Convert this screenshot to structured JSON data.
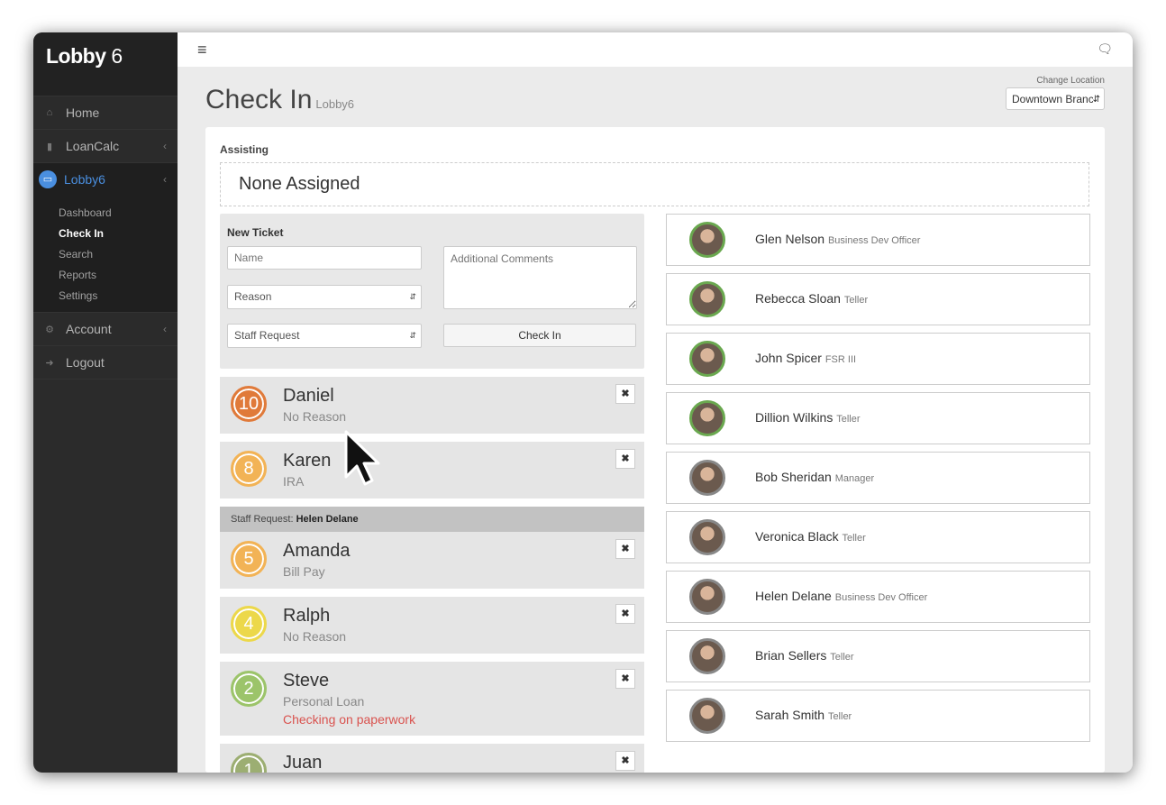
{
  "app": {
    "brand": "Lobby",
    "brand_suffix": "6"
  },
  "sidebar": {
    "items": [
      {
        "label": "Home",
        "icon": "home-icon"
      },
      {
        "label": "LoanCalc",
        "icon": "bar-chart-icon"
      },
      {
        "label": "Lobby6",
        "icon": "tablet-icon"
      },
      {
        "label": "Account",
        "icon": "gear-icon"
      },
      {
        "label": "Logout",
        "icon": "logout-icon"
      }
    ],
    "subitems": [
      "Dashboard",
      "Check In",
      "Search",
      "Reports",
      "Settings"
    ]
  },
  "page": {
    "title": "Check In",
    "subtitle": "Lobby6",
    "location_label": "Change Location",
    "location_value": "Downtown Branch"
  },
  "assisting": {
    "label": "Assisting",
    "value": "None Assigned"
  },
  "new_ticket": {
    "label": "New Ticket",
    "name_placeholder": "Name",
    "reason_value": "Reason",
    "staff_value": "Staff Request",
    "comments_placeholder": "Additional Comments",
    "checkin_label": "Check In"
  },
  "staff_request": {
    "prefix": "Staff Request:",
    "name": "Helen Delane"
  },
  "tickets": [
    {
      "number": "10",
      "name": "Daniel",
      "reason": "No Reason",
      "comment": "",
      "color": "#e07a3a"
    },
    {
      "number": "8",
      "name": "Karen",
      "reason": "IRA",
      "comment": "",
      "color": "#f2b356"
    },
    {
      "number": "5",
      "name": "Amanda",
      "reason": "Bill Pay",
      "comment": "",
      "color": "#f2b356"
    },
    {
      "number": "4",
      "name": "Ralph",
      "reason": "No Reason",
      "comment": "",
      "color": "#ecd84a"
    },
    {
      "number": "2",
      "name": "Steve",
      "reason": "Personal Loan",
      "comment": "Checking on paperwork",
      "color": "#9cc46a"
    },
    {
      "number": "1",
      "name": "Juan",
      "reason": "",
      "comment": "",
      "color": "#9cae72"
    }
  ],
  "staff": [
    {
      "name": "Glen Nelson",
      "role": "Business Dev Officer",
      "ring": "#6aa84f"
    },
    {
      "name": "Rebecca Sloan",
      "role": "Teller",
      "ring": "#6aa84f"
    },
    {
      "name": "John Spicer",
      "role": "FSR III",
      "ring": "#6aa84f"
    },
    {
      "name": "Dillion Wilkins",
      "role": "Teller",
      "ring": "#6aa84f"
    },
    {
      "name": "Bob Sheridan",
      "role": "Manager",
      "ring": "#888888"
    },
    {
      "name": "Veronica Black",
      "role": "Teller",
      "ring": "#888888"
    },
    {
      "name": "Helen Delane",
      "role": "Business Dev Officer",
      "ring": "#888888"
    },
    {
      "name": "Brian Sellers",
      "role": "Teller",
      "ring": "#888888"
    },
    {
      "name": "Sarah Smith",
      "role": "Teller",
      "ring": "#888888"
    }
  ]
}
